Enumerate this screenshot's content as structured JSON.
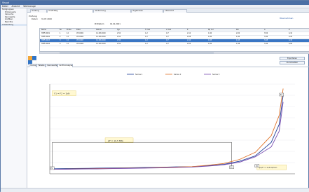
{
  "window": {
    "title": "Visual"
  },
  "menu": [
    "Datei",
    "Ansicht",
    "Werkzeuge"
  ],
  "tree": {
    "items": [
      {
        "label": "Feldgruppen",
        "sub": false
      },
      {
        "label": "Probenserie",
        "sub": true
      },
      {
        "label": "Versuche",
        "sub": true
      },
      {
        "label": "Kennwerte",
        "sub": true
      },
      {
        "label": "Grafiken",
        "sub": true
      },
      {
        "label": "Berichte",
        "sub": true
      },
      {
        "label": "Auswertung",
        "sub": false,
        "selected": true
      }
    ]
  },
  "doc_tabs": [
    {
      "label": "Prüfung"
    },
    {
      "label": "Kraft-Weg",
      "active": true
    },
    {
      "label": "Verformung"
    },
    {
      "label": "Ergebnisse"
    },
    {
      "label": "Übersicht"
    }
  ],
  "props": {
    "group": "Prüfung",
    "date_label": "Datum",
    "date_value": "31.07.2020",
    "field_label": "Prüfdatum",
    "field_value": "01.01.2021"
  },
  "toolbar": {
    "apply": "Übernehmen"
  },
  "grid": {
    "columns": [
      "Name",
      "Nr.",
      "Probe",
      "Datei",
      "Datum",
      "Typ",
      "F max",
      "s max",
      "E",
      "Rp 0.2",
      "Rm",
      "A",
      "Z"
    ],
    "rows": [
      [
        "HMF-0001",
        "1",
        "12",
        "VH-0001",
        "11.08.2020",
        "2,50",
        "1,2",
        "0,7",
        "2,12",
        "1,90",
        "2,00",
        "3,50",
        "4,10"
      ],
      [
        "HMF-0002",
        "2",
        "12",
        "VH-0002",
        "11.08.2020",
        "2,50",
        "1,2",
        "0,7",
        "2,08",
        "1,80",
        "1,90",
        "3,40",
        "4,20"
      ],
      [
        "HMF-0003",
        "3",
        "12",
        "VH-0003",
        "11.08.2020",
        "2,50",
        "1,2",
        "0,7",
        "2,10",
        "1,85",
        "1,95",
        "3,45",
        "4,15"
      ],
      [
        "HMF-0004",
        "4",
        "12",
        "VH-0004",
        "11.08.2020",
        "2,50",
        "1,2",
        "0,7",
        "2,05",
        "1,82",
        "1,98",
        "3,42",
        "4,00"
      ]
    ],
    "selected_row": 2
  },
  "chart_tabs": [
    {
      "label": "Kurve"
    },
    {
      "label": "Tabelle"
    },
    {
      "label": "Kennwerte"
    },
    {
      "label": "Grafik-Analyse",
      "active": true
    }
  ],
  "buttons": {
    "export": "Exportieren",
    "reset": "Zurücksetzen"
  },
  "colors": {
    "accent": "#3a76c4",
    "series_blue": "#1f3f99",
    "series_orange": "#e0742a",
    "series_purple": "#7a4fb2",
    "annot": "#e0c860"
  },
  "chart_data": {
    "type": "line",
    "title": "",
    "xlabel": "",
    "ylabel": "",
    "x": [
      0,
      20,
      40,
      60,
      80,
      100,
      120,
      140,
      160,
      180,
      200,
      220,
      240,
      260,
      280,
      290,
      295
    ],
    "series": [
      {
        "name": "Series 1",
        "color": "#1f3f99",
        "values": [
          91,
          91.5,
          92,
          92.5,
          93,
          93.5,
          94,
          94.5,
          95.5,
          96,
          98,
          101,
          108,
          120,
          150,
          190,
          255
        ]
      },
      {
        "name": "Series 2",
        "color": "#e0742a",
        "values": [
          90,
          90.5,
          91,
          91.5,
          92,
          92.5,
          93,
          94,
          95,
          96,
          99,
          103,
          112,
          128,
          165,
          210,
          270
        ]
      },
      {
        "name": "Series 3",
        "color": "#7a4fb2",
        "values": [
          90,
          90.2,
          90.6,
          91,
          91.5,
          92,
          92.6,
          93.2,
          94,
          95,
          97,
          100,
          106,
          118,
          140,
          175,
          240
        ]
      }
    ],
    "ylim": [
      80,
      280
    ],
    "xlim": [
      0,
      310
    ],
    "annotations": [
      {
        "text": "F1 = F2 = 1kN",
        "x": 8,
        "y": 260
      },
      {
        "text": "ΔF = 10,5 MPa",
        "x": 80,
        "y": 152
      },
      {
        "text": "pk/F = 0,6 N/mm",
        "x": 270,
        "y": 95
      }
    ],
    "markers": [
      "P1",
      "P2",
      "P3",
      "P4"
    ]
  }
}
